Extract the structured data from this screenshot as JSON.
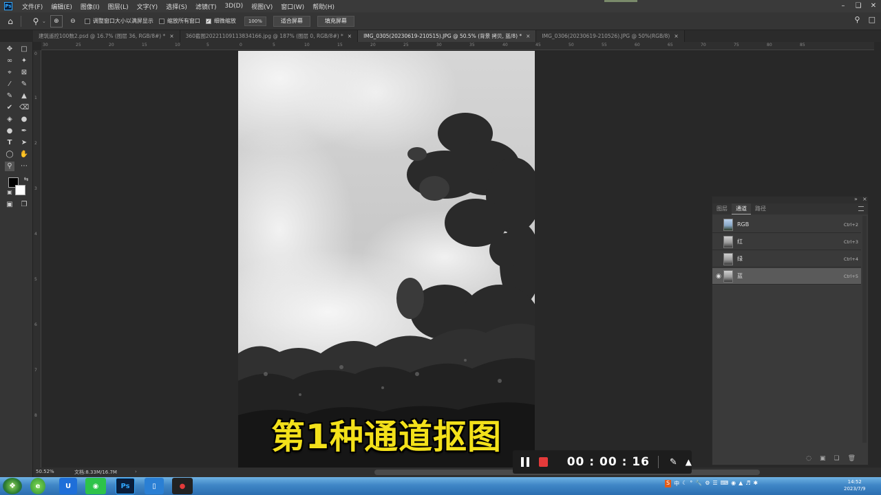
{
  "app": {
    "menu": [
      "文件(F)",
      "编辑(E)",
      "图像(I)",
      "图层(L)",
      "文字(Y)",
      "选择(S)",
      "滤镜(T)",
      "3D(D)",
      "视图(V)",
      "窗口(W)",
      "帮助(H)"
    ]
  },
  "options_bar": {
    "resize_windows": "调整窗口大小以满屏显示",
    "zoom_all_windows": "缩放所有窗口",
    "scrubby_zoom": "细微缩放",
    "zoom_value": "100%",
    "fit_screen": "适合屏幕",
    "fill_screen": "填充屏幕"
  },
  "tabs": [
    {
      "label": "建筑遥控100数2.psd @ 16.7% (图层 36, RGB/8#) *",
      "active": false
    },
    {
      "label": "360截图20221109113834166.jpg @ 187% (图层 0, RGB/8#) *",
      "active": false
    },
    {
      "label": "IMG_0305(20230619-210515).JPG @ 50.5% (背景 拷贝, 蓝/8) *",
      "active": true
    },
    {
      "label": "IMG_0306(20230619-210526).JPG @ 50%(RGB/8)",
      "active": false
    }
  ],
  "rulers": {
    "top": [
      "30",
      "25",
      "20",
      "15",
      "10",
      "5",
      "0",
      "5",
      "10",
      "15",
      "20",
      "25",
      "30",
      "35",
      "40",
      "45",
      "50",
      "55",
      "60",
      "65",
      "70",
      "75",
      "80",
      "85"
    ],
    "left": [
      "0",
      "1",
      "2",
      "3",
      "4",
      "5",
      "6",
      "7",
      "8"
    ]
  },
  "channels_panel": {
    "tabs": [
      "图层",
      "通道",
      "路径"
    ],
    "active_tab": "通道",
    "rows": [
      {
        "name": "RGB",
        "shortcut": "Ctrl+2",
        "visible": false,
        "selected": false
      },
      {
        "name": "红",
        "shortcut": "Ctrl+3",
        "visible": false,
        "selected": false
      },
      {
        "name": "绿",
        "shortcut": "Ctrl+4",
        "visible": false,
        "selected": false
      },
      {
        "name": "蓝",
        "shortcut": "Ctrl+5",
        "visible": true,
        "selected": true
      }
    ]
  },
  "status": {
    "zoom": "50.52%",
    "doc": "文档:8.33M/16.7M"
  },
  "caption": "第1种通道抠图",
  "recorder": {
    "time": "00 : 00 : 16"
  },
  "taskbar": {
    "tray_lang": "中",
    "time": "14:52",
    "date": "2023/7/9"
  },
  "colors": {
    "caption_fill": "#f3e11a",
    "stop_button": "#e43a3a",
    "taskbar": "#3f86c6"
  }
}
